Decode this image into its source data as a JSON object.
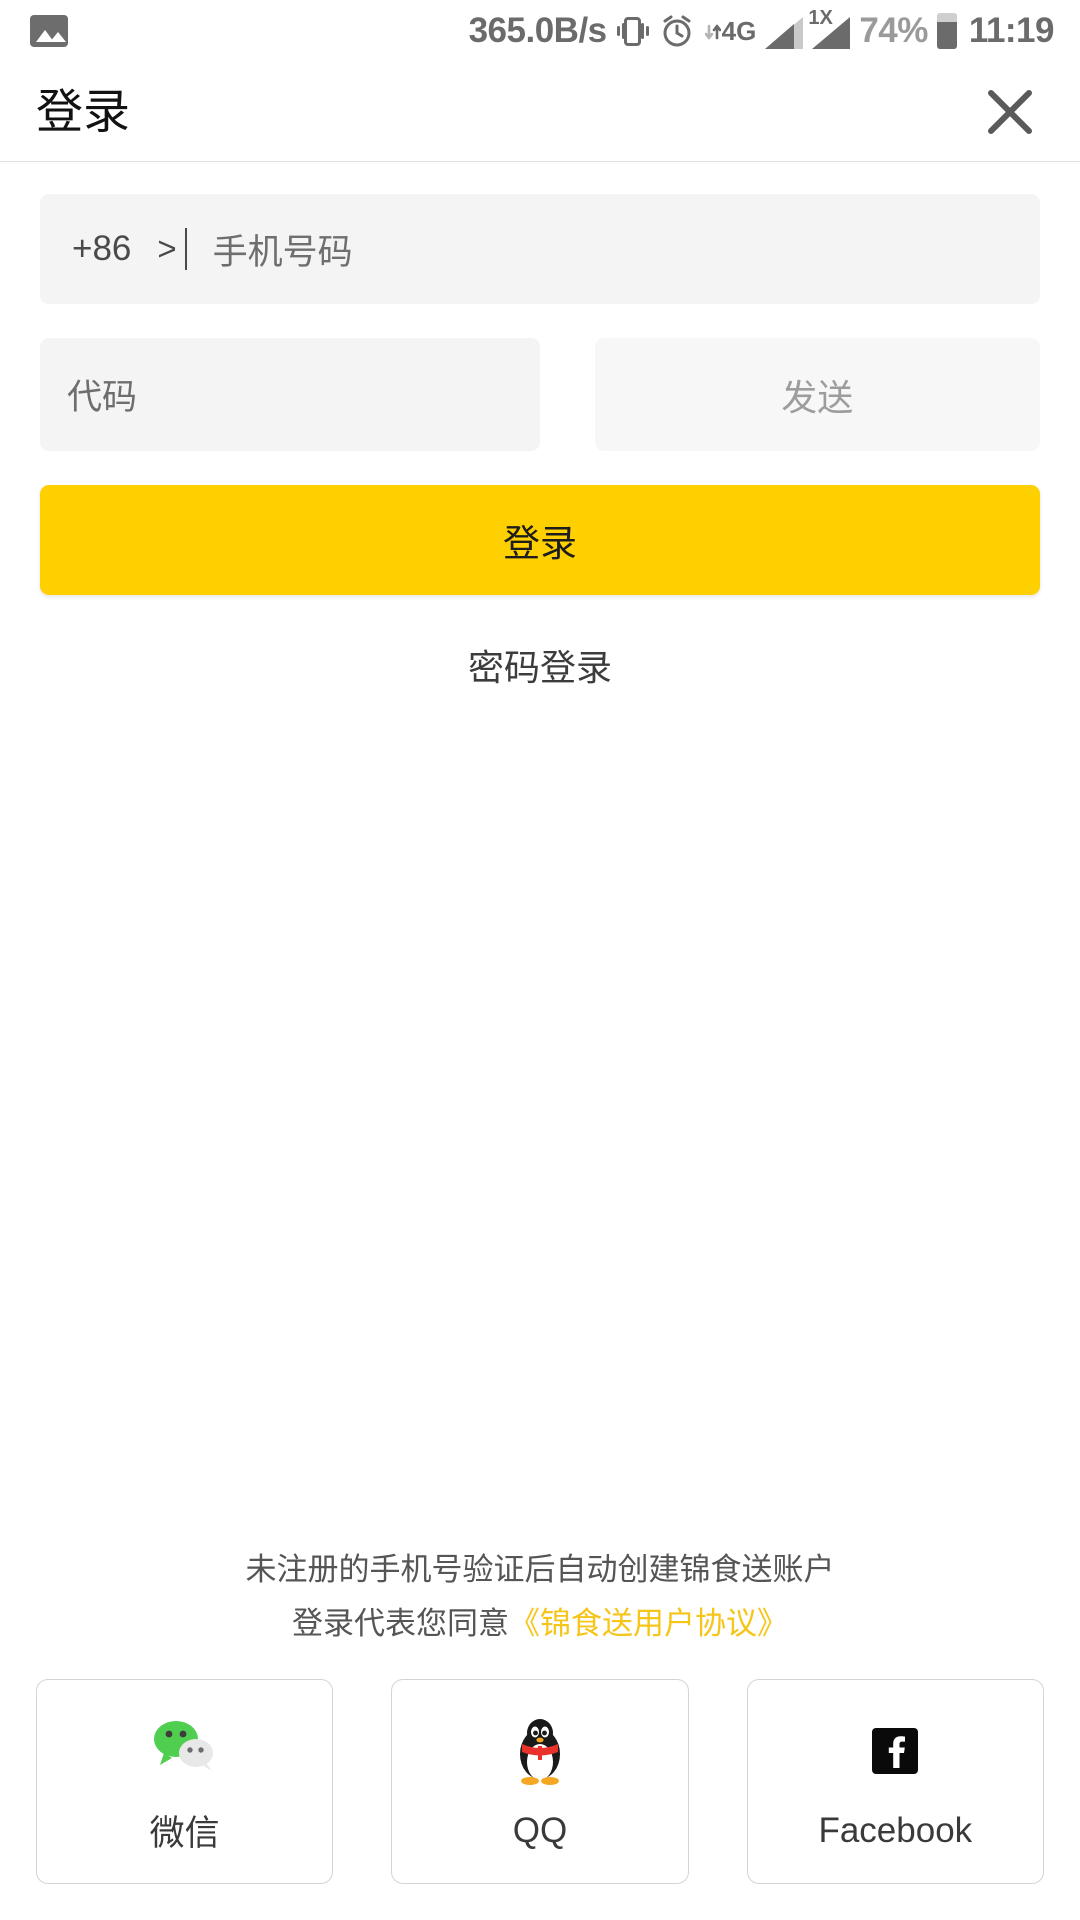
{
  "status_bar": {
    "gallery_icon": "gallery-icon",
    "network_speed": "365.0B/s",
    "vibrate_icon": "vibrate-icon",
    "alarm_icon": "alarm-icon",
    "data_type": "4G",
    "sim1_badge": "",
    "sim2_badge": "1X",
    "battery_percent": "74%",
    "time": "11:19"
  },
  "app_bar": {
    "title": "登录",
    "close_icon": "close-icon"
  },
  "form": {
    "country_code": "+86",
    "country_caret": ">",
    "phone_placeholder": "手机号码",
    "code_placeholder": "代码",
    "send_label": "发送",
    "login_label": "登录",
    "password_login_label": "密码登录"
  },
  "legal": {
    "line1": "未注册的手机号验证后自动创建锦食送账户",
    "line2_prefix": "登录代表您同意",
    "line2_link": "《锦食送用户协议》"
  },
  "social": [
    {
      "label": "微信",
      "icon": "wechat-icon"
    },
    {
      "label": "QQ",
      "icon": "qq-icon"
    },
    {
      "label": "Facebook",
      "icon": "facebook-icon"
    }
  ],
  "colors": {
    "accent_yellow": "#ffd000",
    "link_yellow": "#f5c518",
    "field_gray": "#f4f4f4",
    "wechat_green": "#4fce4f",
    "qq_red": "#e8322a",
    "facebook_black": "#0a0a0a"
  }
}
